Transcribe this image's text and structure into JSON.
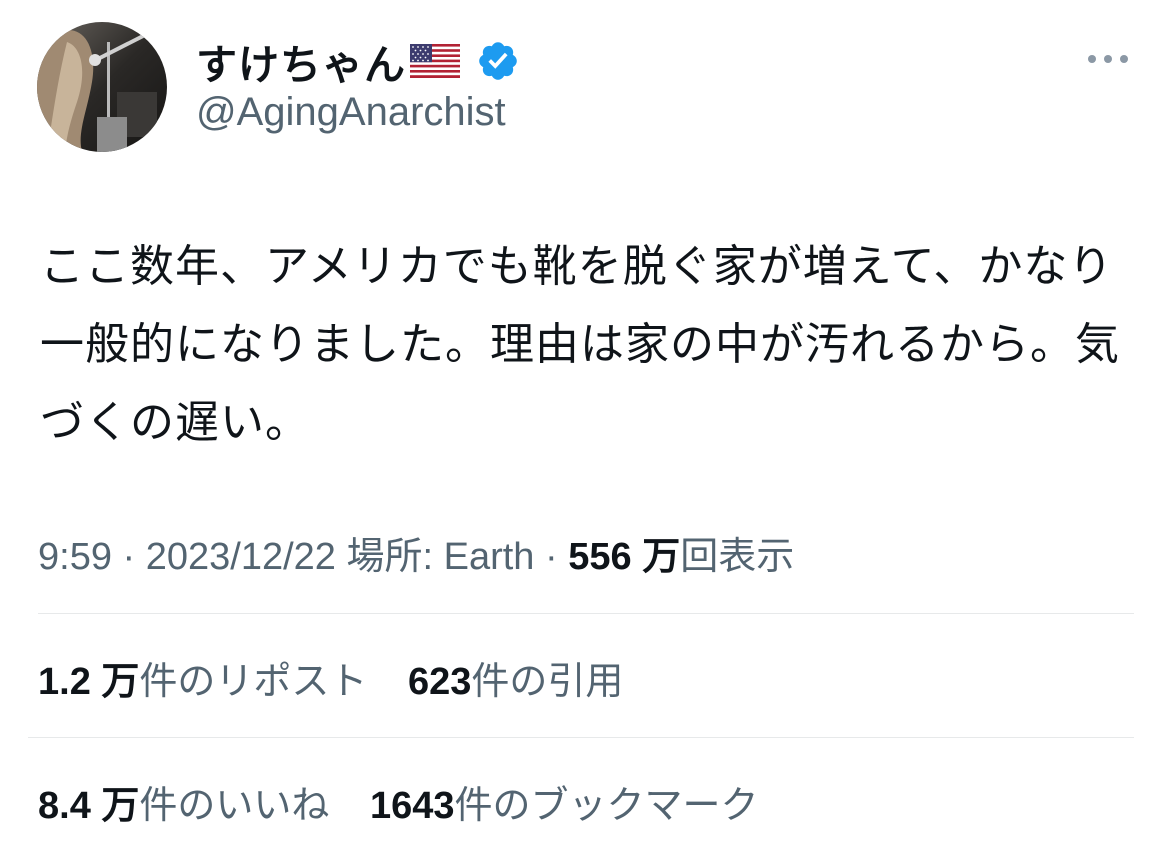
{
  "author": {
    "display_name": "すけちゃん",
    "flag_icon": "us-flag-icon",
    "verified_icon": "verified-badge-icon",
    "verified_color": "#1d9bf0",
    "handle": "@AgingAnarchist"
  },
  "tweet": {
    "text": "ここ数年、アメリカでも靴を脱ぐ家が増えて、かなり一般的になりました。理由は家の中が汚れるから。気づくの遅い。",
    "time": "9:59",
    "date": "2023/12/22",
    "location_label": "場所: Earth",
    "views_count": "556 万",
    "views_label": "回表示"
  },
  "stats": {
    "reposts": {
      "count": "1.2 万",
      "label": "件のリポスト"
    },
    "quotes": {
      "count": "623",
      "label": "件の引用"
    },
    "likes": {
      "count": "8.4 万",
      "label": "件のいいね"
    },
    "bookmarks": {
      "count": "1643",
      "label": "件のブックマーク"
    }
  },
  "colors": {
    "text_primary": "#0f1419",
    "text_secondary": "#536471",
    "divider": "#e7e9ea"
  }
}
